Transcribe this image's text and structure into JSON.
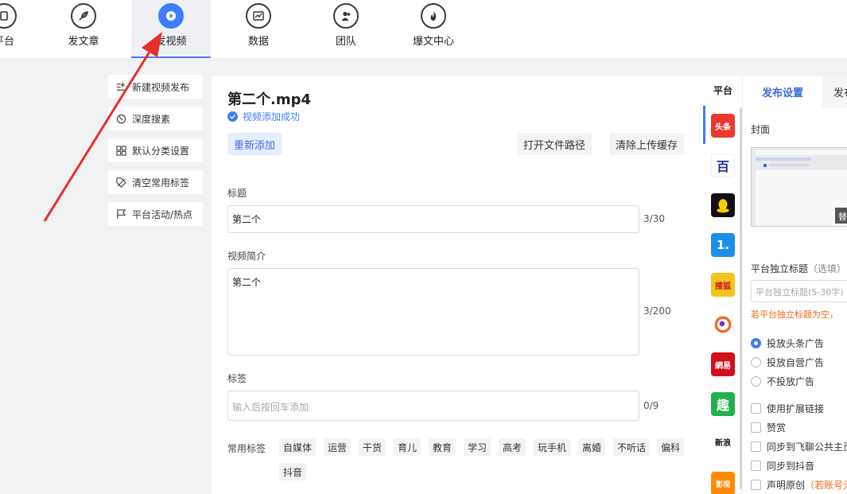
{
  "nav": {
    "items": [
      {
        "label": "平台",
        "icon": "platform-icon"
      },
      {
        "label": "发文章",
        "icon": "feather-icon"
      },
      {
        "label": "发视频",
        "icon": "play-icon"
      },
      {
        "label": "数据",
        "icon": "chart-icon"
      },
      {
        "label": "团队",
        "icon": "team-icon"
      },
      {
        "label": "爆文中心",
        "icon": "fire-icon"
      }
    ]
  },
  "left_menu": {
    "items": [
      {
        "label": "新建视频发布",
        "icon": "new-list-icon"
      },
      {
        "label": "深度搜素",
        "icon": "clock-icon"
      },
      {
        "label": "默认分类设置",
        "icon": "grid-icon"
      },
      {
        "label": "清空常用标签",
        "icon": "tag-clear-icon"
      },
      {
        "label": "平台活动/热点",
        "icon": "flag-icon"
      }
    ]
  },
  "main": {
    "file_name": "第二个.mp4",
    "success_text": "视频添加成功",
    "readd_label": "重新添加",
    "open_path_label": "打开文件路径",
    "clear_cache_label": "清除上传缓存",
    "title_label": "标题",
    "title_value": "第二个",
    "title_count": "3/30",
    "intro_label": "视频简介",
    "intro_value": "第二个",
    "intro_count": "3/200",
    "tags_label": "标签",
    "tags_placeholder": "输入后按回车添加",
    "tags_count": "0/9",
    "common_tags_label": "常用标签",
    "common_tags": [
      "自媒体",
      "运营",
      "干货",
      "育儿",
      "教育",
      "学习",
      "高考",
      "玩手机",
      "离婚",
      "不听话",
      "偏科",
      "抖音"
    ]
  },
  "platforms": {
    "header": "平台",
    "list": [
      {
        "name": "toutiao",
        "text": "头条",
        "color": "#e8382f"
      },
      {
        "name": "baijiahao",
        "text": "百",
        "color": "#ffffff"
      },
      {
        "name": "qq",
        "text": "",
        "color": "#111111"
      },
      {
        "name": "yidian",
        "text": "1.",
        "color": "#1c8fe8"
      },
      {
        "name": "sohu",
        "text": "搜狐",
        "color": "#f3c41b"
      },
      {
        "name": "weibo-video",
        "text": "",
        "color": "#ffffff"
      },
      {
        "name": "netease",
        "text": "網易",
        "color": "#d0111b"
      },
      {
        "name": "qutoutiao",
        "text": "趣",
        "color": "#22b14c"
      },
      {
        "name": "xinlang",
        "text": "新浪",
        "color": "#ffffff"
      },
      {
        "name": "bilibili",
        "text": "影视",
        "color": "#ff8a00"
      }
    ]
  },
  "settings": {
    "tab_publish": "发布设置",
    "tab_other": "发布",
    "cover_label": "封面",
    "cover_badge": "替",
    "indep_title_label": "平台独立标题",
    "indep_title_sub": "（选填）",
    "indep_title_placeholder": "平台独立标题(5-30字)",
    "warning": "若平台独立标题为空，",
    "ad_options": [
      "投放头条广告",
      "投放自营广告",
      "不投放广告"
    ],
    "ad_selected": 0,
    "checks": [
      "使用扩展链接",
      "赞赏",
      "同步到飞聊公共主页",
      "同步到抖音",
      "声明原创"
    ],
    "original_note": "（若账号无"
  }
}
